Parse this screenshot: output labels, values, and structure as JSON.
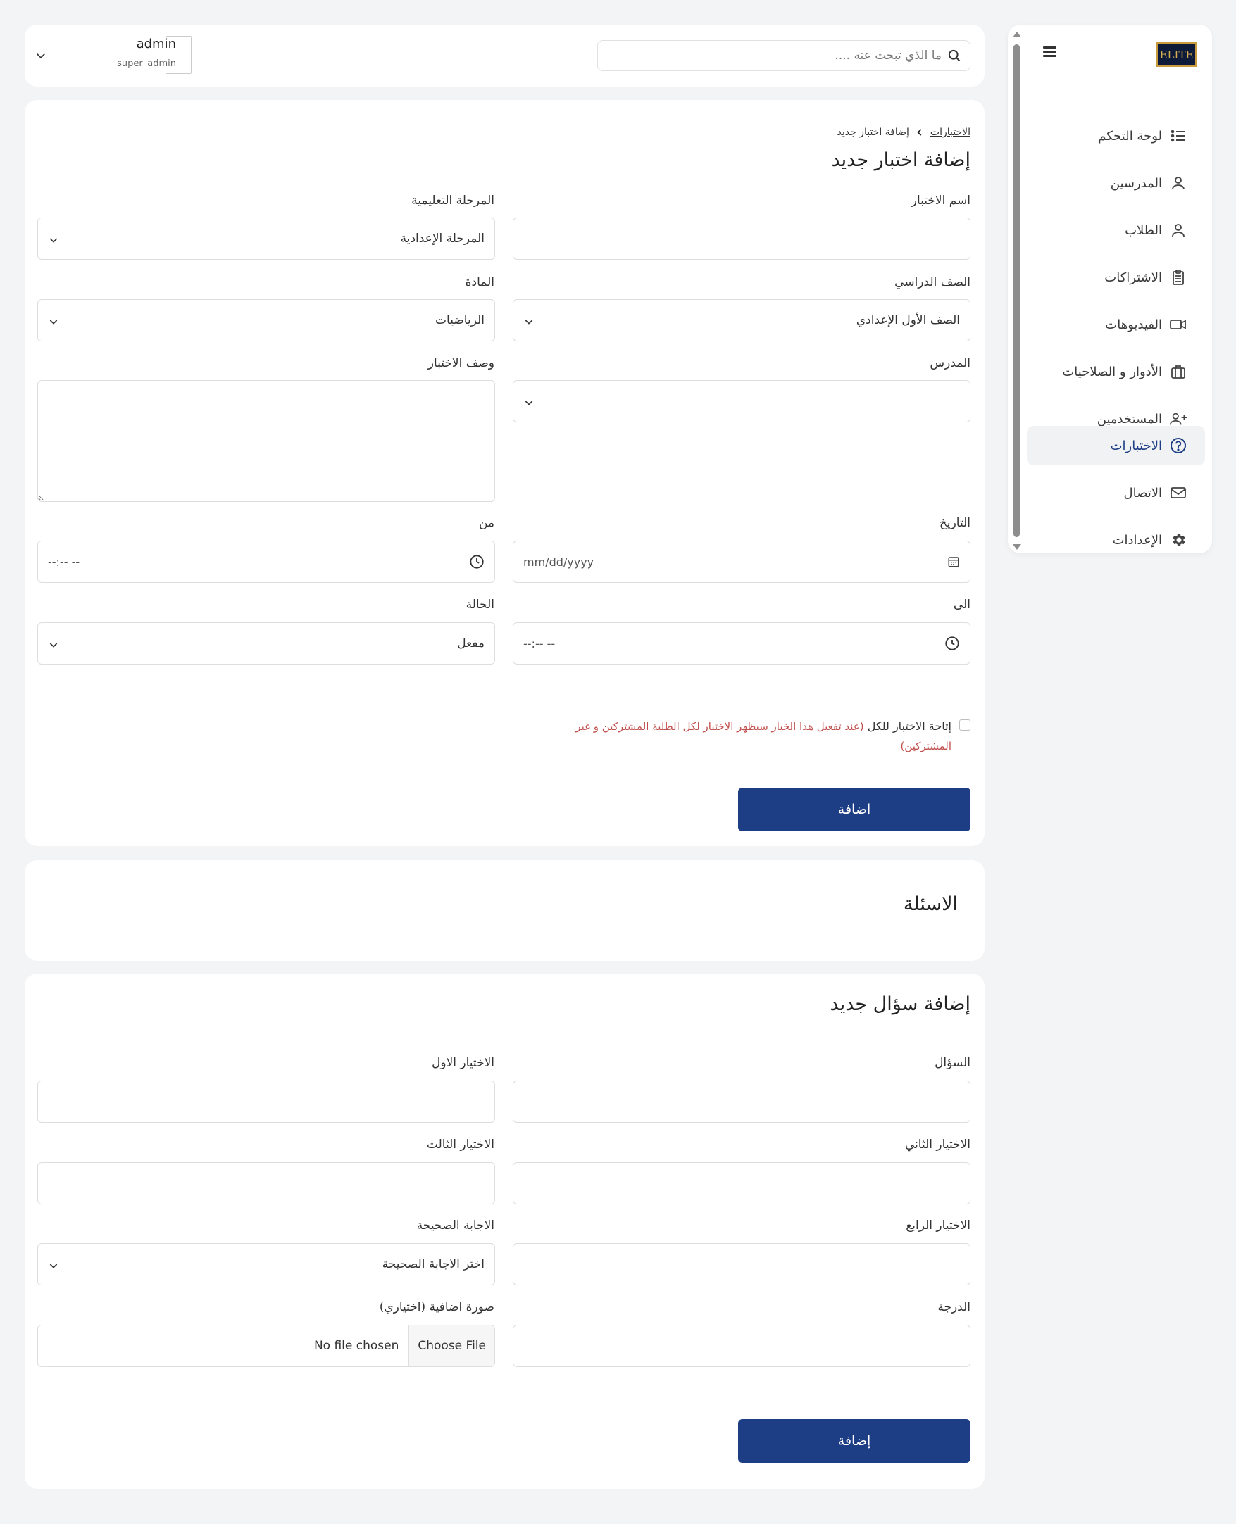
{
  "sidebar": {
    "logo_text": "ELITE",
    "items": [
      {
        "label": "لوحة التحكم",
        "icon": "list-icon"
      },
      {
        "label": "المدرسين",
        "icon": "user-icon"
      },
      {
        "label": "الطلاب",
        "icon": "user-icon"
      },
      {
        "label": "الاشتراكات",
        "icon": "clipboard-icon"
      },
      {
        "label": "الفيديوهات",
        "icon": "video-icon"
      },
      {
        "label": "الأدوار و الصلاحيات",
        "icon": "briefcase-icon"
      },
      {
        "label": "المستخدمين",
        "icon": "user-plus-icon"
      },
      {
        "label": "الاختبارات",
        "icon": "question-circle-icon",
        "active": true
      },
      {
        "label": "الاتصال",
        "icon": "mail-icon"
      },
      {
        "label": "الإعدادات",
        "icon": "gear-icon"
      }
    ]
  },
  "header": {
    "search_placeholder": "ما الذي تبحث عنه ....",
    "user_name": "admin",
    "user_role": "super_admin"
  },
  "quiz_form": {
    "breadcrumb_parent": "الاختبارات",
    "breadcrumb_current": "إضافة اختبار جديد",
    "title": "إضافة اختبار جديد",
    "name_label": "اسم الاختبار",
    "name_value": "",
    "stage_label": "المرحلة التعليمية",
    "stage_value": "المرحلة الإعدادية",
    "grade_label": "الصف الدراسي",
    "grade_value": "الصف الأول الإعدادي",
    "subject_label": "المادة",
    "subject_value": "الرياضيات",
    "teacher_label": "المدرس",
    "teacher_value": "",
    "description_label": "وصف الاختبار",
    "date_label": "التاريخ",
    "date_placeholder": "mm/dd/yyyy",
    "from_label": "من",
    "from_placeholder": "--:-- --",
    "to_label": "الى",
    "to_placeholder": "--:-- --",
    "status_label": "الحالة",
    "status_value": "مفعل",
    "public_label": "إتاحة الاختبار للكل",
    "public_note": "(عند تفعيل هذا الخيار سيظهر الاختبار لكل الطلبة المشتركين و غير المشتركين)",
    "submit_label": "اضافة"
  },
  "questions_section": {
    "title": "الاسئلة"
  },
  "question_form": {
    "title": "إضافة سؤال جديد",
    "question_label": "السؤال",
    "choice1_label": "الاختيار الاول",
    "choice2_label": "الاختيار الثاني",
    "choice3_label": "الاختيار الثالث",
    "choice4_label": "الاختيار الرابع",
    "correct_label": "الاجابة الصحيحة",
    "correct_placeholder": "اختر الاجابة الصحيحة",
    "score_label": "الدرجة",
    "image_label": "صورة اضافية (اختياري)",
    "choose_file_label": "Choose File",
    "no_file_label": "No file chosen",
    "submit_label": "إضافة"
  },
  "colors": {
    "primary": "#1d3d85",
    "background": "#f3f4f6",
    "note_red": "#c0504d"
  }
}
